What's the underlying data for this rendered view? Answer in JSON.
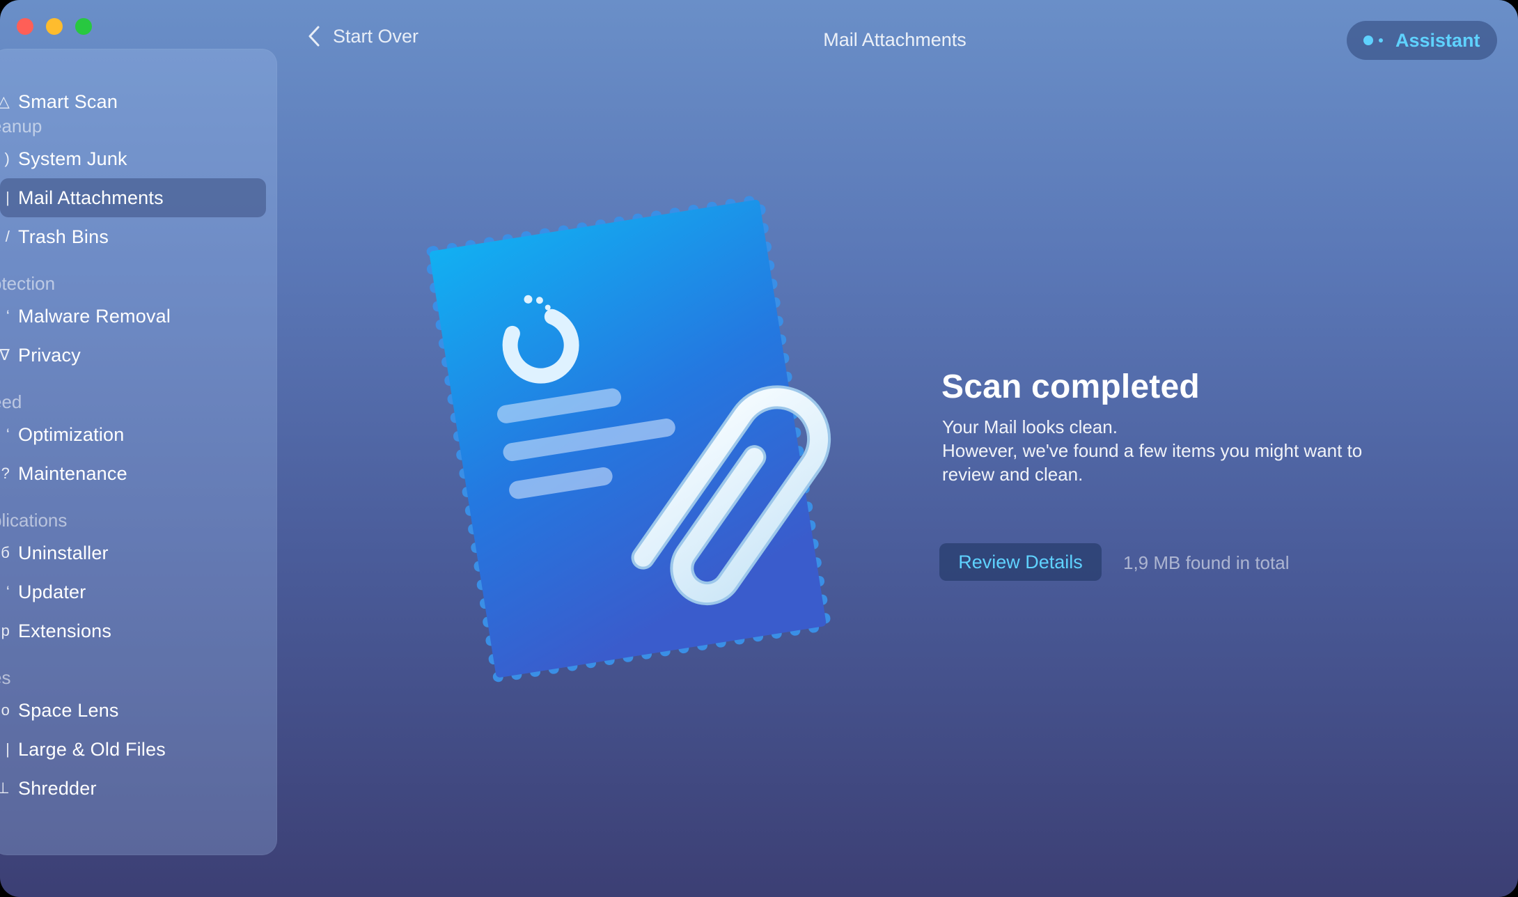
{
  "header": {
    "back_label": "Start Over",
    "title": "Mail Attachments",
    "assistant_label": "Assistant"
  },
  "sidebar": {
    "smart_scan": "Smart Scan",
    "sections": {
      "cleanup": "eanup",
      "protection": "otection",
      "speed": "eed",
      "applications": "plications",
      "files": "es"
    },
    "items": {
      "system_junk": "System Junk",
      "mail_attachments": "Mail Attachments",
      "trash_bins": "Trash Bins",
      "malware_removal": "Malware Removal",
      "privacy": "Privacy",
      "optimization": "Optimization",
      "maintenance": "Maintenance",
      "uninstaller": "Uninstaller",
      "updater": "Updater",
      "extensions": "Extensions",
      "space_lens": "Space Lens",
      "large_old_files": "Large & Old Files",
      "shredder": "Shredder"
    },
    "selected": "mail_attachments"
  },
  "result": {
    "title": "Scan completed",
    "line1": "Your Mail looks clean.",
    "line2": "However, we've found a few items you might want to",
    "line3": "review and clean.",
    "review_button": "Review Details",
    "found_text": "1,9 MB found in total"
  },
  "colors": {
    "accent": "#5fd2ff",
    "close": "#fe5f57",
    "minimize": "#febc2e",
    "maximize": "#28c840"
  },
  "icons": [
    "chevron-left-icon",
    "assistant-dots-icon",
    "mail-stamp-icon",
    "paperclip-icon",
    "progress-ring-icon"
  ]
}
